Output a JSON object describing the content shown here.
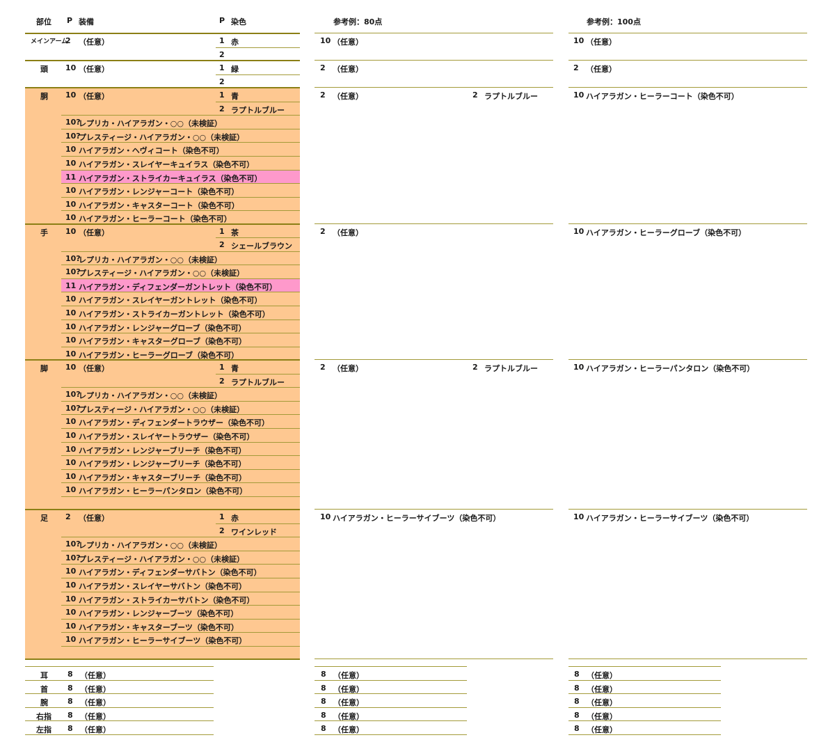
{
  "header": {
    "part": "部位",
    "p1": "P",
    "equip": "装備",
    "p2": "P",
    "dye": "染色",
    "ref80": "参考例：80点",
    "ref100": "参考例：100点"
  },
  "sections": [
    {
      "label": "メインアーム",
      "label_small": true,
      "rows": [
        {
          "p": "2",
          "equip": "（任意）",
          "dp": "1",
          "dye": "赤"
        },
        {
          "p": "",
          "equip": "",
          "dp": "2",
          "dye": ""
        }
      ],
      "ref80": [
        {
          "p": "10",
          "equip": "（任意）"
        }
      ],
      "ref100": [
        {
          "p": "10",
          "equip": "（任意）"
        }
      ]
    },
    {
      "label": "頭",
      "rows": [
        {
          "p": "10",
          "equip": "（任意）",
          "dp": "1",
          "dye": "緑"
        },
        {
          "p": "",
          "equip": "",
          "dp": "2",
          "dye": ""
        }
      ],
      "ref80": [
        {
          "p": "2",
          "equip": "（任意）"
        }
      ],
      "ref100": [
        {
          "p": "2",
          "equip": "（任意）"
        }
      ]
    },
    {
      "label": "胴",
      "rows": [
        {
          "p": "10",
          "equip": "（任意）",
          "dp": "1",
          "dye": "青"
        },
        {
          "p": "",
          "equip": "",
          "dp": "2",
          "dye": "ラプトルブルー"
        },
        {
          "p": "10?",
          "equip": "レプリカ・ハイアラガン・○○（未検証）"
        },
        {
          "p": "10?",
          "equip": "プレスティージ・ハイアラガン・○○（未検証）"
        },
        {
          "p": "10",
          "equip": "ハイアラガン・ヘヴィコート（染色不可）"
        },
        {
          "p": "10",
          "equip": "ハイアラガン・スレイヤーキュイラス（染色不可）"
        },
        {
          "p": "11",
          "equip": "ハイアラガン・ストライカーキュイラス（染色不可）",
          "highlight": true
        },
        {
          "p": "10",
          "equip": "ハイアラガン・レンジャーコート（染色不可）"
        },
        {
          "p": "10",
          "equip": "ハイアラガン・キャスターコート（染色不可）"
        },
        {
          "p": "10",
          "equip": "ハイアラガン・ヒーラーコート（染色不可）"
        }
      ],
      "ref80": [
        {
          "p": "2",
          "equip": "（任意）",
          "dp": "2",
          "dye": "ラプトルブルー"
        }
      ],
      "ref100": [
        {
          "p": "10",
          "equip": "ハイアラガン・ヒーラーコート（染色不可）"
        }
      ]
    },
    {
      "label": "手",
      "rows": [
        {
          "p": "10",
          "equip": "（任意）",
          "dp": "1",
          "dye": "茶"
        },
        {
          "p": "",
          "equip": "",
          "dp": "2",
          "dye": "シェールブラウン"
        },
        {
          "p": "10?",
          "equip": "レプリカ・ハイアラガン・○○（未検証）"
        },
        {
          "p": "10?",
          "equip": "プレスティージ・ハイアラガン・○○（未検証）"
        },
        {
          "p": "11",
          "equip": "ハイアラガン・ディフェンダーガントレット（染色不可）",
          "highlight": true
        },
        {
          "p": "10",
          "equip": "ハイアラガン・スレイヤーガントレット（染色不可）"
        },
        {
          "p": "10",
          "equip": "ハイアラガン・ストライカーガントレット（染色不可）"
        },
        {
          "p": "10",
          "equip": "ハイアラガン・レンジャーグローブ（染色不可）"
        },
        {
          "p": "10",
          "equip": "ハイアラガン・キャスターグローブ（染色不可）"
        },
        {
          "p": "10",
          "equip": "ハイアラガン・ヒーラーグローブ（染色不可）"
        }
      ],
      "ref80": [
        {
          "p": "2",
          "equip": "（任意）"
        }
      ],
      "ref100": [
        {
          "p": "10",
          "equip": "ハイアラガン・ヒーラーグローブ（染色不可）"
        }
      ]
    },
    {
      "label": "脚",
      "rows": [
        {
          "p": "10",
          "equip": "（任意）",
          "dp": "1",
          "dye": "青"
        },
        {
          "p": "",
          "equip": "",
          "dp": "2",
          "dye": "ラプトルブルー"
        },
        {
          "p": "10?",
          "equip": "レプリカ・ハイアラガン・○○（未検証）"
        },
        {
          "p": "10?",
          "equip": "プレスティージ・ハイアラガン・○○（未検証）"
        },
        {
          "p": "10",
          "equip": "ハイアラガン・ディフェンダートラウザー（染色不可）"
        },
        {
          "p": "10",
          "equip": "ハイアラガン・スレイヤートラウザー（染色不可）"
        },
        {
          "p": "10",
          "equip": "ハイアラガン・レンジャーブリーチ（染色不可）"
        },
        {
          "p": "10",
          "equip": "ハイアラガン・レンジャーブリーチ（染色不可）"
        },
        {
          "p": "10",
          "equip": "ハイアラガン・キャスターブリーチ（染色不可）"
        },
        {
          "p": "10",
          "equip": "ハイアラガン・ヒーラーパンタロン（染色不可）"
        },
        {
          "p": "",
          "equip": "",
          "blank": true
        }
      ],
      "ref80": [
        {
          "p": "2",
          "equip": "（任意）",
          "dp": "2",
          "dye": "ラプトルブルー"
        }
      ],
      "ref100": [
        {
          "p": "10",
          "equip": "ハイアラガン・ヒーラーパンタロン（染色不可）"
        }
      ]
    },
    {
      "label": "足",
      "rows": [
        {
          "p": "2",
          "equip": "（任意）",
          "dp": "1",
          "dye": "赤"
        },
        {
          "p": "",
          "equip": "",
          "dp": "2",
          "dye": "ワインレッド"
        },
        {
          "p": "10?",
          "equip": "レプリカ・ハイアラガン・○○（未検証）"
        },
        {
          "p": "10?",
          "equip": "プレスティージ・ハイアラガン・○○（未検証）"
        },
        {
          "p": "10",
          "equip": "ハイアラガン・ディフェンダーサバトン（染色不可）"
        },
        {
          "p": "10",
          "equip": "ハイアラガン・スレイヤーサバトン（染色不可）"
        },
        {
          "p": "10",
          "equip": "ハイアラガン・ストライカーサバトン（染色不可）"
        },
        {
          "p": "10",
          "equip": "ハイアラガン・レンジャーブーツ（染色不可）"
        },
        {
          "p": "10",
          "equip": "ハイアラガン・キャスターブーツ（染色不可）"
        },
        {
          "p": "10",
          "equip": "ハイアラガン・ヒーラーサイブーツ（染色不可）"
        },
        {
          "p": "",
          "equip": "",
          "blank": true
        }
      ],
      "ref80": [
        {
          "p": "10",
          "equip": "ハイアラガン・ヒーラーサイブーツ（染色不可）"
        }
      ],
      "ref100": [
        {
          "p": "10",
          "equip": "ハイアラガン・ヒーラーサイブーツ（染色不可）"
        }
      ]
    }
  ],
  "accessories": [
    {
      "label": "耳",
      "p": "8",
      "equip": "（任意）",
      "r80p": "8",
      "r80": "（任意）",
      "r100p": "8",
      "r100": "（任意）"
    },
    {
      "label": "首",
      "p": "8",
      "equip": "（任意）",
      "r80p": "8",
      "r80": "（任意）",
      "r100p": "8",
      "r100": "（任意）"
    },
    {
      "label": "腕",
      "p": "8",
      "equip": "（任意）",
      "r80p": "8",
      "r80": "（任意）",
      "r100p": "8",
      "r100": "（任意）"
    },
    {
      "label": "右指",
      "p": "8",
      "equip": "（任意）",
      "r80p": "8",
      "r80": "（任意）",
      "r100p": "8",
      "r100": "（任意）"
    },
    {
      "label": "左指",
      "p": "8",
      "equip": "（任意）",
      "r80p": "8",
      "r80": "（任意）",
      "r100p": "8",
      "r100": "（任意）"
    }
  ],
  "colors": {
    "orange": "#fec891",
    "pink": "#fe99cb",
    "rule": "#a39a38",
    "rule_dark": "#8b7f15"
  }
}
